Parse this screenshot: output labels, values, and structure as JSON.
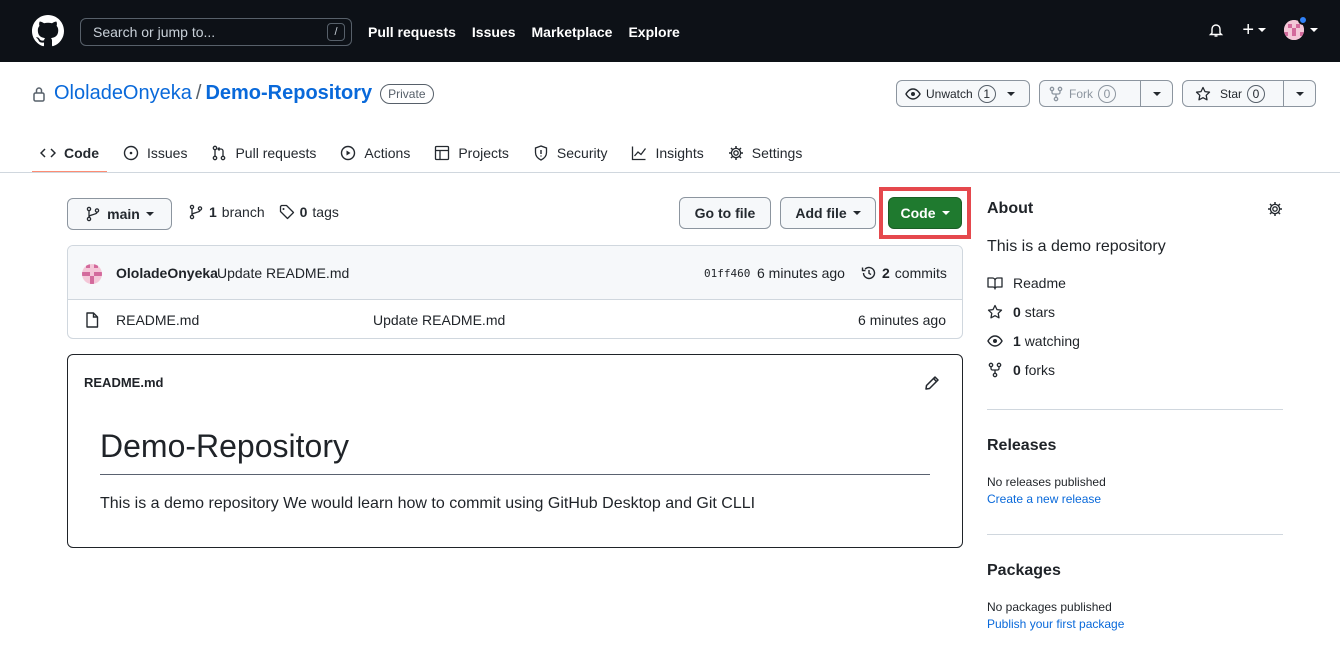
{
  "header": {
    "search_placeholder": "Search or jump to...",
    "search_shortcut": "/",
    "nav": [
      "Pull requests",
      "Issues",
      "Marketplace",
      "Explore"
    ],
    "plus_label": "+"
  },
  "repo": {
    "owner": "OloladeOnyeka",
    "separator": "/",
    "name": "Demo-Repository",
    "visibility": "Private",
    "unwatch_label": "Unwatch",
    "watch_count": "1",
    "fork_label": "Fork",
    "fork_count": "0",
    "star_label": "Star",
    "star_count": "0"
  },
  "tabs": [
    {
      "label": "Code",
      "icon": "code-icon"
    },
    {
      "label": "Issues",
      "icon": "issue-icon"
    },
    {
      "label": "Pull requests",
      "icon": "pull-request-icon"
    },
    {
      "label": "Actions",
      "icon": "play-icon"
    },
    {
      "label": "Projects",
      "icon": "table-icon"
    },
    {
      "label": "Security",
      "icon": "shield-icon"
    },
    {
      "label": "Insights",
      "icon": "graph-icon"
    },
    {
      "label": "Settings",
      "icon": "gear-icon"
    }
  ],
  "filenav": {
    "branch": "main",
    "branch_count": "1",
    "branch_word": "branch",
    "tag_count": "0",
    "tag_word": "tags",
    "goto_file": "Go to file",
    "add_file": "Add file",
    "code_button": "Code"
  },
  "commit": {
    "author": "OloladeOnyeka",
    "message": "Update README.md",
    "sha": "01ff460",
    "time": "6 minutes ago",
    "count": "2",
    "count_word": "commits"
  },
  "files": [
    {
      "name": "README.md",
      "message": "Update README.md",
      "time": "6 minutes ago"
    }
  ],
  "readme": {
    "filename": "README.md",
    "heading": "Demo-Repository",
    "body": "This is a demo repository We would learn how to commit using GitHub Desktop and Git CLLI"
  },
  "sidebar": {
    "about_title": "About",
    "description": "This is a demo repository",
    "readme_label": "Readme",
    "stars_count": "0",
    "stars_word": "stars",
    "watching_count": "1",
    "watching_word": "watching",
    "forks_count": "0",
    "forks_word": "forks",
    "releases_title": "Releases",
    "releases_text": "No releases published",
    "releases_link": "Create a new release",
    "packages_title": "Packages",
    "packages_text": "No packages published",
    "packages_link": "Publish your first package"
  },
  "colors": {
    "header_bg": "#0d1117",
    "link": "#0969da",
    "code_button": "#1f7a2f",
    "highlight": "#e5484d",
    "active_tab_underline": "#fd8c73"
  }
}
